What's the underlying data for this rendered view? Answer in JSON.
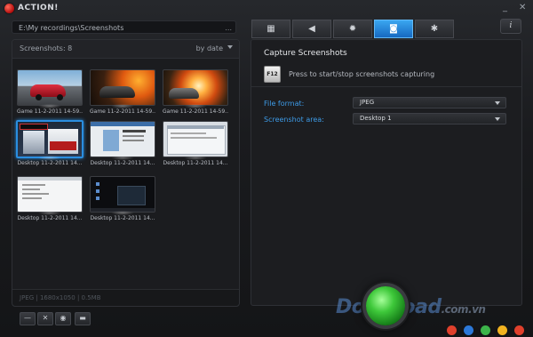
{
  "window": {
    "title": "ACTION!",
    "minimize": "_",
    "close": "✕"
  },
  "recordings": {
    "path": "E:\\My recordings\\Screenshots",
    "path_more": "...",
    "count_label": "Screenshots: 8",
    "sort_label": "by date"
  },
  "thumbnails": [
    {
      "caption": "Game 11-2-2011 14-59...",
      "kind": "car-red"
    },
    {
      "caption": "Game 11-2-2011 14-59...",
      "kind": "car-fire"
    },
    {
      "caption": "Game 11-2-2011 14-59...",
      "kind": "car-explosion"
    },
    {
      "caption": "Desktop 11-2-2011 14...",
      "kind": "desktop-action",
      "selected": true
    },
    {
      "caption": "Desktop 11-2-2011 14...",
      "kind": "desktop-web"
    },
    {
      "caption": "Desktop 11-2-2011 14...",
      "kind": "desktop-window"
    },
    {
      "caption": "Desktop 11-2-2011 14...",
      "kind": "desktop-white"
    },
    {
      "caption": "Desktop 11-2-2011 14...",
      "kind": "desktop-dark"
    }
  ],
  "footer_info": "JPEG | 1680x1050 | 0.5MB",
  "toolbar": {
    "minus": "—",
    "delete": "✕",
    "view": "◉",
    "folder": "▬"
  },
  "tabs": [
    {
      "name": "video-tab",
      "icon": "▦"
    },
    {
      "name": "audio-tab",
      "icon": "◀"
    },
    {
      "name": "webcam-tab",
      "icon": "✹"
    },
    {
      "name": "screenshot-tab",
      "icon": "◙",
      "active": true
    },
    {
      "name": "settings-tab",
      "icon": "✱"
    }
  ],
  "info_label": "i",
  "capture": {
    "title": "Capture Screenshots",
    "hotkey": "F12",
    "hint": "Press to start/stop screenshots capturing",
    "file_format_label": "File format:",
    "file_format_value": "JPEG",
    "area_label": "Screenshot area:",
    "area_value": "Desktop 1"
  },
  "watermark": {
    "main": "Download",
    "suffix": ".com.vn"
  },
  "colors": {
    "accent": "#2a8ee0",
    "record": "#3ec83a",
    "label": "#3d9ae6"
  }
}
